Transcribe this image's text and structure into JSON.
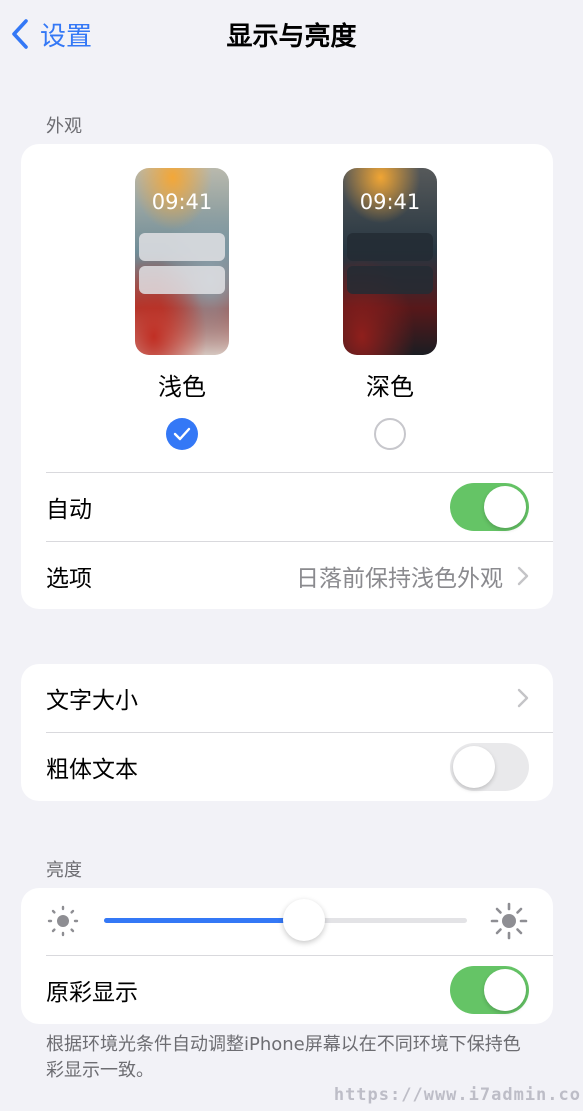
{
  "nav": {
    "back_label": "设置",
    "title": "显示与亮度"
  },
  "appearance": {
    "header": "外观",
    "options": [
      {
        "label": "浅色",
        "time": "09:41",
        "selected": true
      },
      {
        "label": "深色",
        "time": "09:41",
        "selected": false
      }
    ],
    "auto": {
      "label": "自动",
      "on": true
    },
    "options_row": {
      "label": "选项",
      "value": "日落前保持浅色外观"
    }
  },
  "text": {
    "text_size_label": "文字大小",
    "bold_text": {
      "label": "粗体文本",
      "on": false
    }
  },
  "brightness": {
    "header": "亮度",
    "level": 0.55,
    "true_tone": {
      "label": "原彩显示",
      "on": true
    },
    "note": "根据环境光条件自动调整iPhone屏幕以在不同环境下保持色彩显示一致。"
  },
  "watermark": "https://www.i7admin.co",
  "colors": {
    "accent": "#3478f6",
    "toggle_on": "#65c466",
    "background": "#f2f2f7"
  }
}
